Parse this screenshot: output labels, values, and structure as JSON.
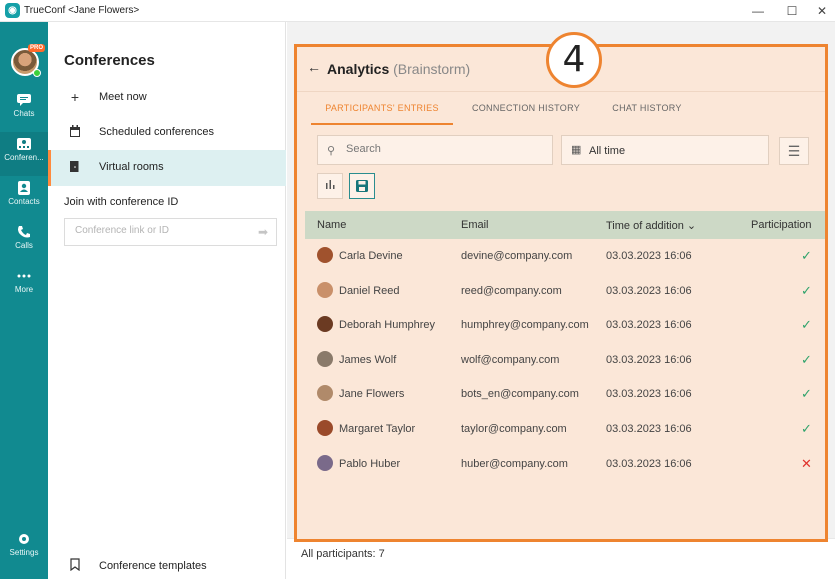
{
  "window": {
    "title": "TrueConf <Jane Flowers>",
    "minimize": "—",
    "maximize": "☐",
    "close": "✕"
  },
  "rail": {
    "pro_badge": "PRO",
    "items": [
      {
        "label": "Chats",
        "icon": "chat-icon"
      },
      {
        "label": "Conferen...",
        "icon": "conference-icon"
      },
      {
        "label": "Contacts",
        "icon": "contacts-icon"
      },
      {
        "label": "Calls",
        "icon": "calls-icon"
      },
      {
        "label": "More",
        "icon": "more-icon"
      }
    ],
    "settings_label": "Settings"
  },
  "conferences": {
    "title": "Conferences",
    "items": [
      {
        "label": "Meet now",
        "icon": "plus-icon"
      },
      {
        "label": "Scheduled conferences",
        "icon": "calendar-icon"
      },
      {
        "label": "Virtual rooms",
        "icon": "door-icon"
      }
    ],
    "join_title": "Join with conference ID",
    "join_placeholder": "Conference link or ID",
    "templates_label": "Conference templates"
  },
  "callout": {
    "number": "4"
  },
  "analytics": {
    "title": "Analytics",
    "subtitle": "(Brainstorm)",
    "tabs": [
      "PARTICIPANTS' ENTRIES",
      "CONNECTION HISTORY",
      "CHAT HISTORY"
    ],
    "search_placeholder": "Search",
    "date_filter": "All time",
    "columns": [
      "Name",
      "Email",
      "Time of addition ⌄",
      "Participation"
    ],
    "rows": [
      {
        "name": "Carla Devine",
        "email": "devine@company.com",
        "time": "03.03.2023 16:06",
        "participation": "✓",
        "ok": true,
        "avatar_color": "#a0522d"
      },
      {
        "name": "Daniel Reed",
        "email": "reed@company.com",
        "time": "03.03.2023 16:06",
        "participation": "✓",
        "ok": true,
        "avatar_color": "#c9906a"
      },
      {
        "name": "Deborah Humphrey",
        "email": "humphrey@company.com",
        "time": "03.03.2023 16:06",
        "participation": "✓",
        "ok": true,
        "avatar_color": "#6b3a22"
      },
      {
        "name": "James Wolf",
        "email": "wolf@company.com",
        "time": "03.03.2023 16:06",
        "participation": "✓",
        "ok": true,
        "avatar_color": "#8a7a6a"
      },
      {
        "name": "Jane Flowers",
        "email": "bots_en@company.com",
        "time": "03.03.2023 16:06",
        "participation": "✓",
        "ok": true,
        "avatar_color": "#b08a6a"
      },
      {
        "name": "Margaret Taylor",
        "email": "taylor@company.com",
        "time": "03.03.2023 16:06",
        "participation": "✓",
        "ok": true,
        "avatar_color": "#9a4a2a"
      },
      {
        "name": "Pablo Huber",
        "email": "huber@company.com",
        "time": "03.03.2023 16:06",
        "participation": "✕",
        "ok": false,
        "avatar_color": "#7a6a8a"
      }
    ],
    "footer": "All participants: 7"
  },
  "colors": {
    "accent": "#ee8430",
    "rail": "#118a90",
    "ok": "#2fa36b",
    "error": "#e0312b"
  }
}
